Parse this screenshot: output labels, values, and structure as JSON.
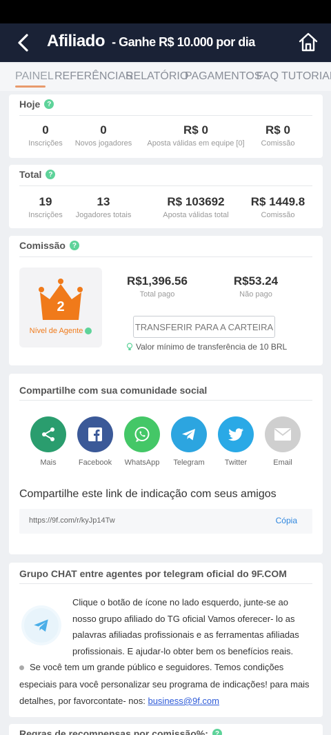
{
  "header": {
    "title": "Afiliado",
    "subtitle": "- Ganhe R$ 10.000 por dia",
    "back_icon": "chevron-left-icon",
    "home_icon": "home-icon"
  },
  "tabs": [
    "PAINEL",
    "REFERÊNCIAS",
    "RELATÓRIO",
    "PAGAMENTOS",
    "FAQ",
    "TUTORIAL"
  ],
  "active_tab": "PAINEL",
  "today": {
    "title": "Hoje",
    "stats": [
      {
        "value": "0",
        "label": "Inscrições"
      },
      {
        "value": "0",
        "label": "Novos jogadores"
      },
      {
        "value": "R$ 0",
        "label": "Aposta válidas em equipe [0]"
      },
      {
        "value": "R$ 0",
        "label": "Comissão"
      }
    ]
  },
  "total": {
    "title": "Total",
    "stats": [
      {
        "value": "19",
        "label": "Inscrições"
      },
      {
        "value": "13",
        "label": "Jogadores totais"
      },
      {
        "value": "R$ 103692",
        "label": "Aposta válidas total"
      },
      {
        "value": "R$ 1449.8",
        "label": "Comissão"
      }
    ]
  },
  "commission": {
    "title": "Comissão",
    "agent_level": "2",
    "agent_label": "Nível de Agente",
    "total_paid": {
      "value": "R$1,396.56",
      "label": "Total pago"
    },
    "unpaid": {
      "value": "R$53.24",
      "label": "Não pago"
    },
    "transfer_button": "TRANSFERIR PARA A CARTEIRA",
    "min_note": "Valor mínimo de transferência de 10 BRL"
  },
  "share": {
    "title": "Compartilhe com sua comunidade social",
    "networks": [
      {
        "label": "Mais",
        "icon": "share-icon",
        "color": "#2a9d6e"
      },
      {
        "label": "Facebook",
        "icon": "facebook-icon",
        "color": "#3b5998"
      },
      {
        "label": "WhatsApp",
        "icon": "whatsapp-icon",
        "color": "#44c767"
      },
      {
        "label": "Telegram",
        "icon": "telegram-icon",
        "color": "#2ca5e0"
      },
      {
        "label": "Twitter",
        "icon": "twitter-icon",
        "color": "#2aa9e6"
      },
      {
        "label": "Email",
        "icon": "email-icon",
        "color": "#cfcfcf"
      }
    ],
    "link_title": "Compartilhe este link de indicação com seus amigos",
    "link": "https://9f.com/r/kyJp14Tw",
    "copy_label": "Cópia"
  },
  "telegram_group": {
    "title": "Grupo CHAT entre agentes por telegram oficial do 9F.COM",
    "text": "Clique o botão de ícone no lado esquerdo, junte-se ao nosso grupo afiliado do TG oficial Vamos oferecer- lo as palavras afiliadas profissionais e as ferramentas afiliadas profissionais. E ajudar-lo obter bem os benefícios reais.",
    "note": "Se você tem um grande público e seguidores. Temos condições especiais para você personalizar seu programa de indicações! para mais detalhes, por favorcontate- nos:",
    "email": "business@9f.com"
  },
  "rules_title": "Regras de recompensas por comissão%:"
}
